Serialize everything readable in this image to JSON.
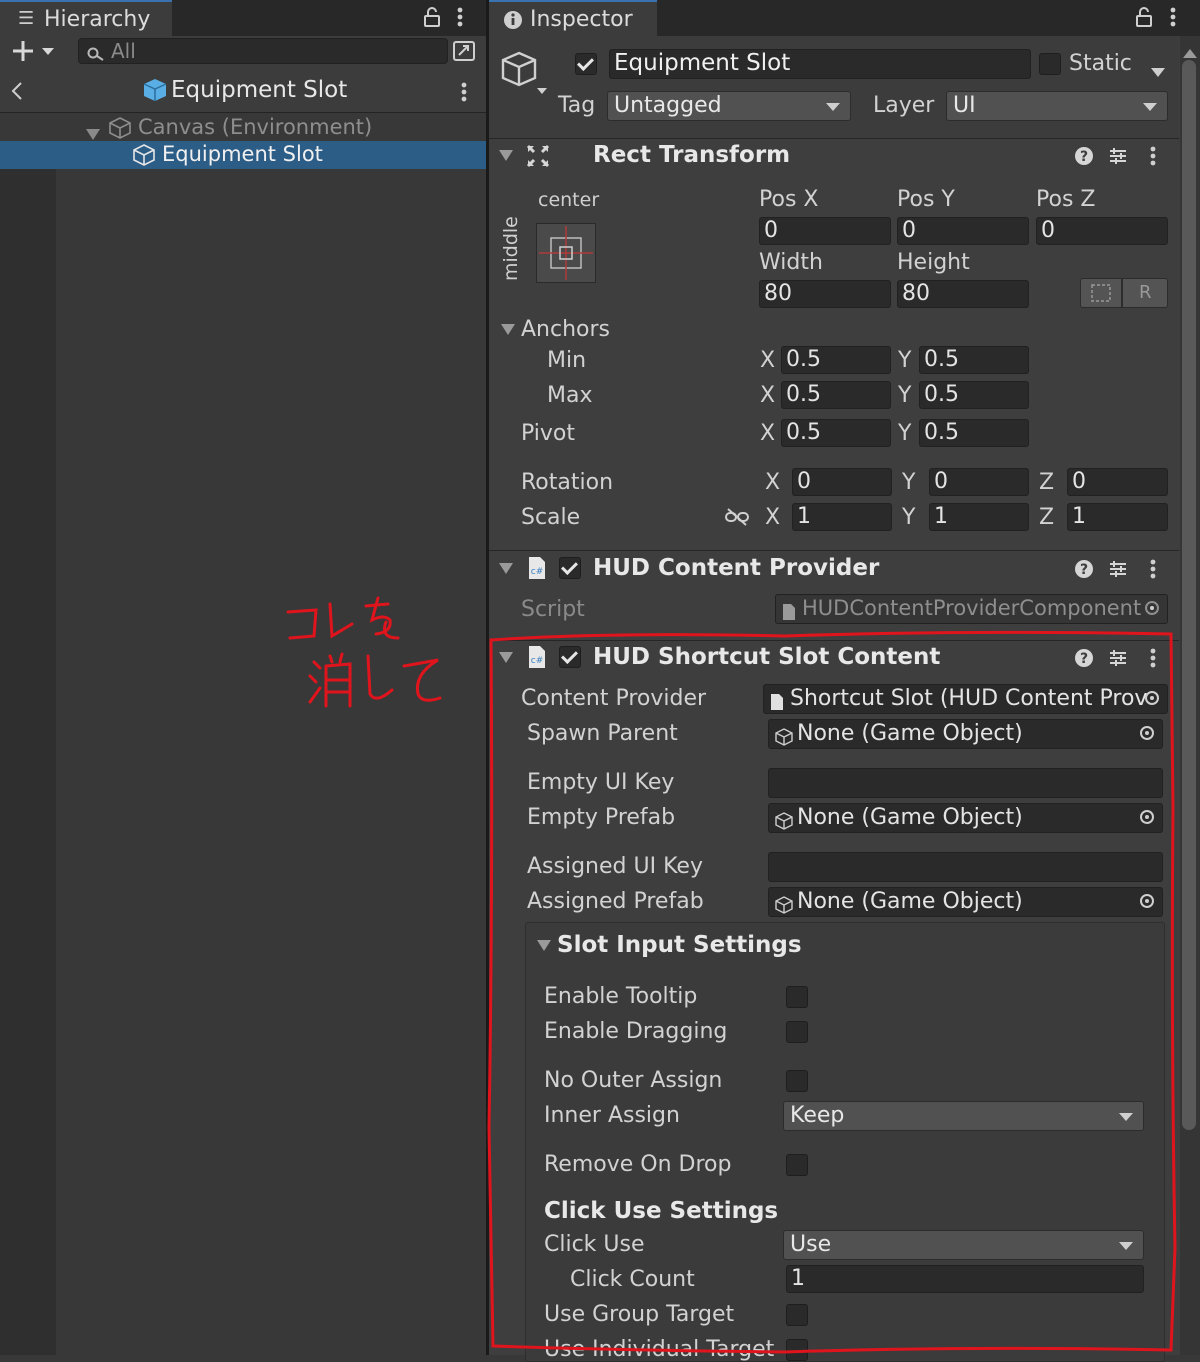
{
  "hierarchy": {
    "tab_title": "Hierarchy",
    "search_placeholder": "All",
    "scene_title": "Equipment Slot",
    "tree": [
      {
        "label": "Canvas (Environment)"
      },
      {
        "label": "Equipment Slot"
      }
    ]
  },
  "inspector": {
    "tab_title": "Inspector",
    "object_name": "Equipment Slot",
    "static_label": "Static",
    "tag_label": "Tag",
    "tag_value": "Untagged",
    "layer_label": "Layer",
    "layer_value": "UI",
    "rect_transform": {
      "title": "Rect Transform",
      "anchor_h": "center",
      "anchor_v": "middle",
      "pos_x_label": "Pos X",
      "pos_y_label": "Pos Y",
      "pos_z_label": "Pos Z",
      "pos_x": "0",
      "pos_y": "0",
      "pos_z": "0",
      "width_label": "Width",
      "height_label": "Height",
      "width": "80",
      "height": "80",
      "r_button": "R",
      "anchors_label": "Anchors",
      "min_label": "Min",
      "max_label": "Max",
      "pivot_label": "Pivot",
      "min_x": "0.5",
      "min_y": "0.5",
      "max_x": "0.5",
      "max_y": "0.5",
      "pivot_x": "0.5",
      "pivot_y": "0.5",
      "rotation_label": "Rotation",
      "scale_label": "Scale",
      "rot_x": "0",
      "rot_y": "0",
      "rot_z": "0",
      "scale_x": "1",
      "scale_y": "1",
      "scale_z": "1",
      "axis_x": "X",
      "axis_y": "Y",
      "axis_z": "Z"
    },
    "hud_content_provider": {
      "title": "HUD Content Provider",
      "script_label": "Script",
      "script_value": "HUDContentProviderComponent"
    },
    "hud_shortcut_slot": {
      "title": "HUD Shortcut Slot Content",
      "content_provider_label": "Content Provider",
      "content_provider_value": "Shortcut Slot (HUD Content Prov",
      "spawn_parent_label": "Spawn Parent",
      "spawn_parent_value": "None (Game Object)",
      "empty_ui_key_label": "Empty UI Key",
      "empty_ui_key_value": "",
      "empty_prefab_label": "Empty Prefab",
      "empty_prefab_value": "None (Game Object)",
      "assigned_ui_key_label": "Assigned UI Key",
      "assigned_ui_key_value": "",
      "assigned_prefab_label": "Assigned Prefab",
      "assigned_prefab_value": "None (Game Object)",
      "slot_input_settings": "Slot Input Settings",
      "enable_tooltip": "Enable Tooltip",
      "enable_dragging": "Enable Dragging",
      "no_outer_assign": "No Outer Assign",
      "inner_assign_label": "Inner Assign",
      "inner_assign_value": "Keep",
      "remove_on_drop": "Remove On Drop",
      "click_use_settings": "Click Use Settings",
      "click_use_label": "Click Use",
      "click_use_value": "Use",
      "click_count_label": "Click Count",
      "click_count_value": "1",
      "use_group_target": "Use Group Target",
      "use_individual_target": "Use Individual Target"
    }
  },
  "annotation": {
    "handwritten_note": "コレを消して",
    "color": "#e0141c"
  },
  "colors": {
    "selection": "#2c5d87",
    "panel": "#3e3e3e",
    "field": "#2a2a2a"
  }
}
